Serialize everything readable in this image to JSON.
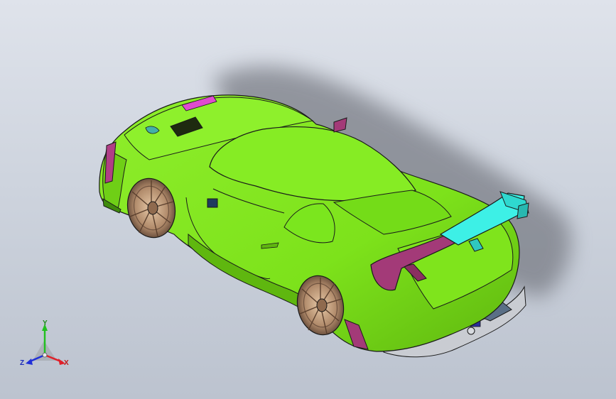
{
  "viewport": {
    "background_top": "#dfe3eb",
    "background_bottom": "#bcc3cf"
  },
  "model": {
    "body_color": "#7de21b",
    "body_shade": "#5fb70f",
    "wing_color": "#3df0e6",
    "wing_end_color": "#a33a78",
    "accent_magenta": "#e04bd0",
    "wheel_color": "#b08a6a",
    "diffuser_color": "#c9ccd2",
    "outline_color": "#1a1a1a",
    "shadow_color": "#6d7078"
  },
  "triad": {
    "x_label": "X",
    "y_label": "Y",
    "z_label": "Z",
    "x_color": "#e0202a",
    "y_color": "#22c020",
    "z_color": "#2030d8"
  }
}
